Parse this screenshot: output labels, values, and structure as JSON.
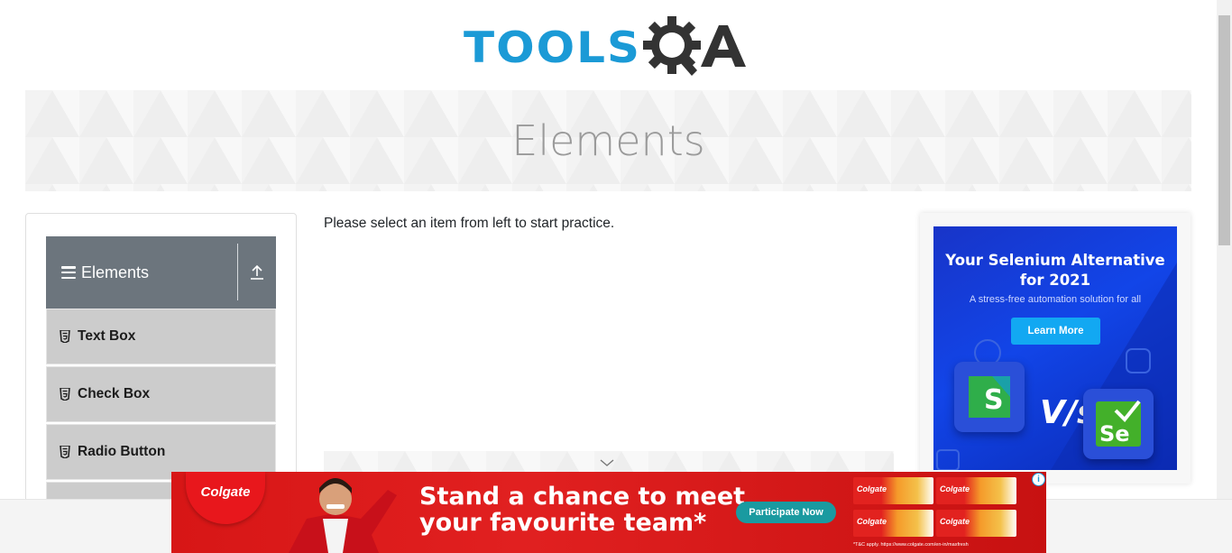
{
  "header": {
    "logo_text": "TOOLS",
    "logo_suffix": "QA"
  },
  "banner": {
    "title": "Elements"
  },
  "sidebar": {
    "group_title": "Elements",
    "items": [
      {
        "label": "Text Box"
      },
      {
        "label": "Check Box"
      },
      {
        "label": "Radio Button"
      }
    ]
  },
  "main": {
    "instructions": "Please select an item from left to start practice."
  },
  "right_ad": {
    "headline_line1": "Your Selenium Alternative",
    "headline_line2": "for 2021",
    "subtext": "A stress-free automation solution for all",
    "button_label": "Learn More",
    "vs_text": "V/s",
    "tile_left_letter": "S",
    "tile_right_letters": "Se"
  },
  "bottom_ad": {
    "brand": "Colgate",
    "headline_line1": "Stand a chance to meet",
    "headline_line2": "your favourite team*",
    "button_label": "Participate Now",
    "terms": "*T&C apply. https://www.colgate.com/en-in/maxfresh",
    "tube_label": "Colgate"
  },
  "colors": {
    "logo_blue": "#1b9ad6",
    "logo_dark": "#333333",
    "sidebar_header": "#6c757d",
    "menu_item_bg": "#cccccc",
    "ad_blue": "#1245e8",
    "ad_button": "#12a8f2",
    "bottom_ad_red": "#e12020",
    "participate_button": "#1a9aa0"
  }
}
